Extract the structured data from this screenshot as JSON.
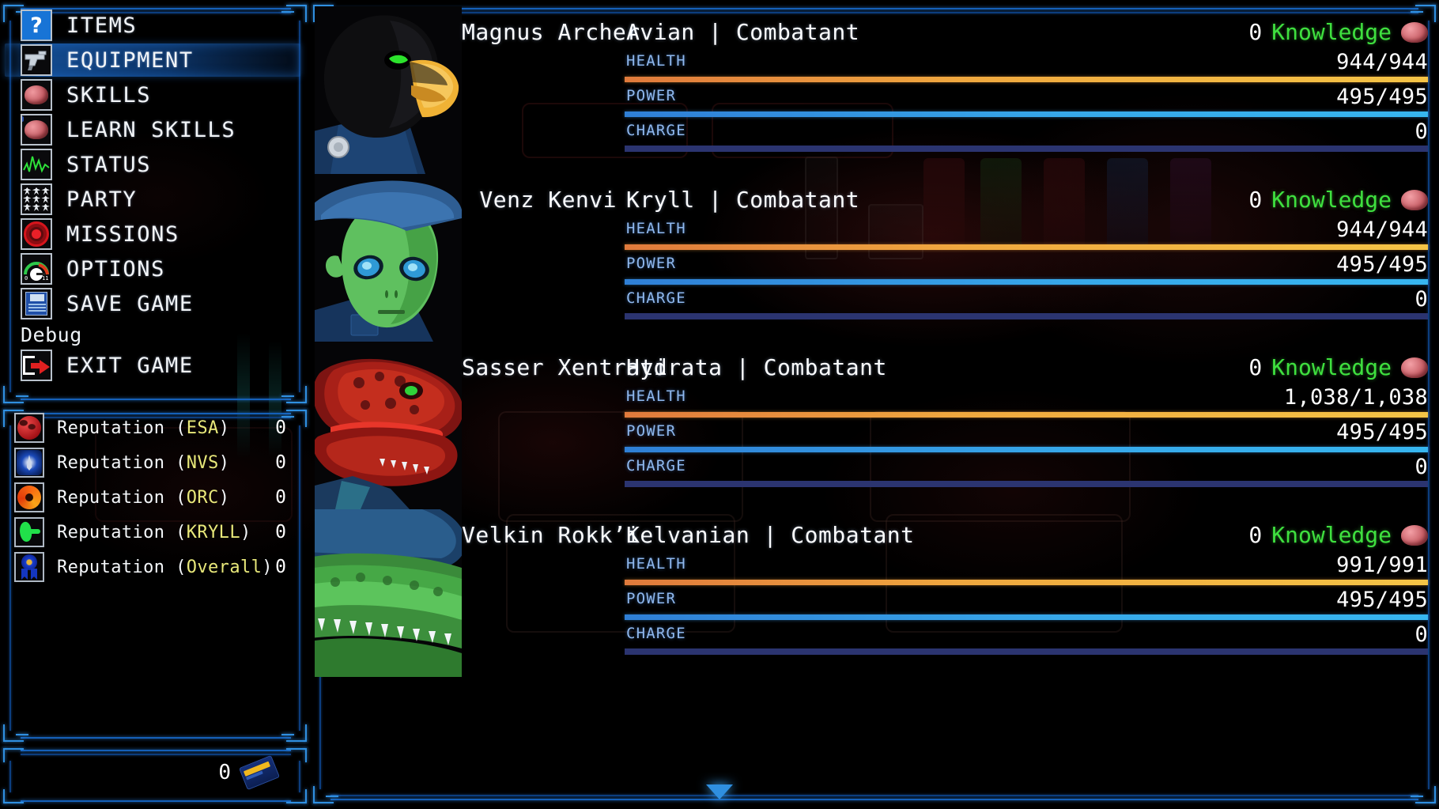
{
  "sidebar": {
    "menu_items": [
      {
        "label": "ITEMS",
        "icon": "question-mark-icon",
        "selected": false
      },
      {
        "label": "EQUIPMENT",
        "icon": "pistol-icon",
        "selected": true
      },
      {
        "label": "SKILLS",
        "icon": "brain-icon",
        "selected": false
      },
      {
        "label": "LEARN SKILLS",
        "icon": "brain-chip-icon",
        "selected": false
      },
      {
        "label": "STATUS",
        "icon": "waveform-icon",
        "selected": false
      },
      {
        "label": "PARTY",
        "icon": "people-group-icon",
        "selected": false
      },
      {
        "label": "MISSIONS",
        "icon": "target-icon",
        "selected": false
      },
      {
        "label": "OPTIONS",
        "icon": "dial-gauge-icon",
        "selected": false
      },
      {
        "label": "SAVE GAME",
        "icon": "floppy-disk-icon",
        "selected": false
      }
    ],
    "debug_label": "Debug",
    "debug_items": [
      {
        "label": "EXIT GAME",
        "icon": "exit-door-icon"
      }
    ],
    "reputation": [
      {
        "label_prefix": "Reputation (",
        "faction": "ESA",
        "label_suffix": ")",
        "value": "0",
        "icon": "red-earth-icon"
      },
      {
        "label_prefix": "Reputation (",
        "faction": "NVS",
        "label_suffix": ")",
        "value": "0",
        "icon": "blue-shield-icon"
      },
      {
        "label_prefix": "Reputation (",
        "faction": "ORC",
        "label_suffix": ")",
        "value": "0",
        "icon": "orange-phoenix-icon"
      },
      {
        "label_prefix": "Reputation (",
        "faction": "KRYLL",
        "label_suffix": ")",
        "value": "0",
        "icon": "green-claw-icon"
      },
      {
        "label_prefix": "Reputation (",
        "faction": "Overall",
        "label_suffix": ")",
        "value": "0",
        "icon": "blue-ribbon-icon"
      }
    ],
    "currency": {
      "value": "0",
      "icon": "credit-card-icon"
    }
  },
  "characters": [
    {
      "name": "Magnus Archer",
      "race": "Avian",
      "separator": "|",
      "role": "Combatant",
      "knowledge_value": "0",
      "knowledge_label": "Knowledge",
      "portrait": "avian-eagle-portrait",
      "stats": [
        {
          "name": "HEALTH",
          "value": "944/944",
          "fill": 100,
          "kind": "hp"
        },
        {
          "name": "POWER",
          "value": "495/495",
          "fill": 100,
          "kind": "pw"
        },
        {
          "name": "CHARGE",
          "value": "0",
          "fill": 100,
          "kind": "ch"
        }
      ]
    },
    {
      "name": "Venz Kenvi",
      "race": "Kryll",
      "separator": "|",
      "role": "Combatant",
      "knowledge_value": "0",
      "knowledge_label": "Knowledge",
      "portrait": "green-alien-portrait",
      "stats": [
        {
          "name": "HEALTH",
          "value": "944/944",
          "fill": 100,
          "kind": "hp"
        },
        {
          "name": "POWER",
          "value": "495/495",
          "fill": 100,
          "kind": "pw"
        },
        {
          "name": "CHARGE",
          "value": "0",
          "fill": 100,
          "kind": "ch"
        }
      ]
    },
    {
      "name": "Sasser Xentrati",
      "race": "Hydrata",
      "separator": "|",
      "role": "Combatant",
      "knowledge_value": "0",
      "knowledge_label": "Knowledge",
      "portrait": "red-reptile-portrait",
      "stats": [
        {
          "name": "HEALTH",
          "value": "1,038/1,038",
          "fill": 100,
          "kind": "hp"
        },
        {
          "name": "POWER",
          "value": "495/495",
          "fill": 100,
          "kind": "pw"
        },
        {
          "name": "CHARGE",
          "value": "0",
          "fill": 100,
          "kind": "ch"
        }
      ]
    },
    {
      "name": "Velkin Rokk’i",
      "race": "Kelvanian",
      "separator": "|",
      "role": "Combatant",
      "knowledge_value": "0",
      "knowledge_label": "Knowledge",
      "portrait": "green-croc-portrait",
      "stats": [
        {
          "name": "HEALTH",
          "value": "991/991",
          "fill": 100,
          "kind": "hp"
        },
        {
          "name": "POWER",
          "value": "495/495",
          "fill": 100,
          "kind": "pw"
        },
        {
          "name": "CHARGE",
          "value": "0",
          "fill": 100,
          "kind": "ch"
        }
      ]
    }
  ],
  "scroll_indicator": "chevron-down-icon",
  "colors": {
    "frame_blue": "#1560b8",
    "accent_blue": "#2f8fe0",
    "knowledge_green": "#3fe03f",
    "faction_yellow": "#e8e87a",
    "health_orange": "#f0a83f",
    "power_blue": "#37a8ea",
    "charge_navy": "#2b3470"
  }
}
